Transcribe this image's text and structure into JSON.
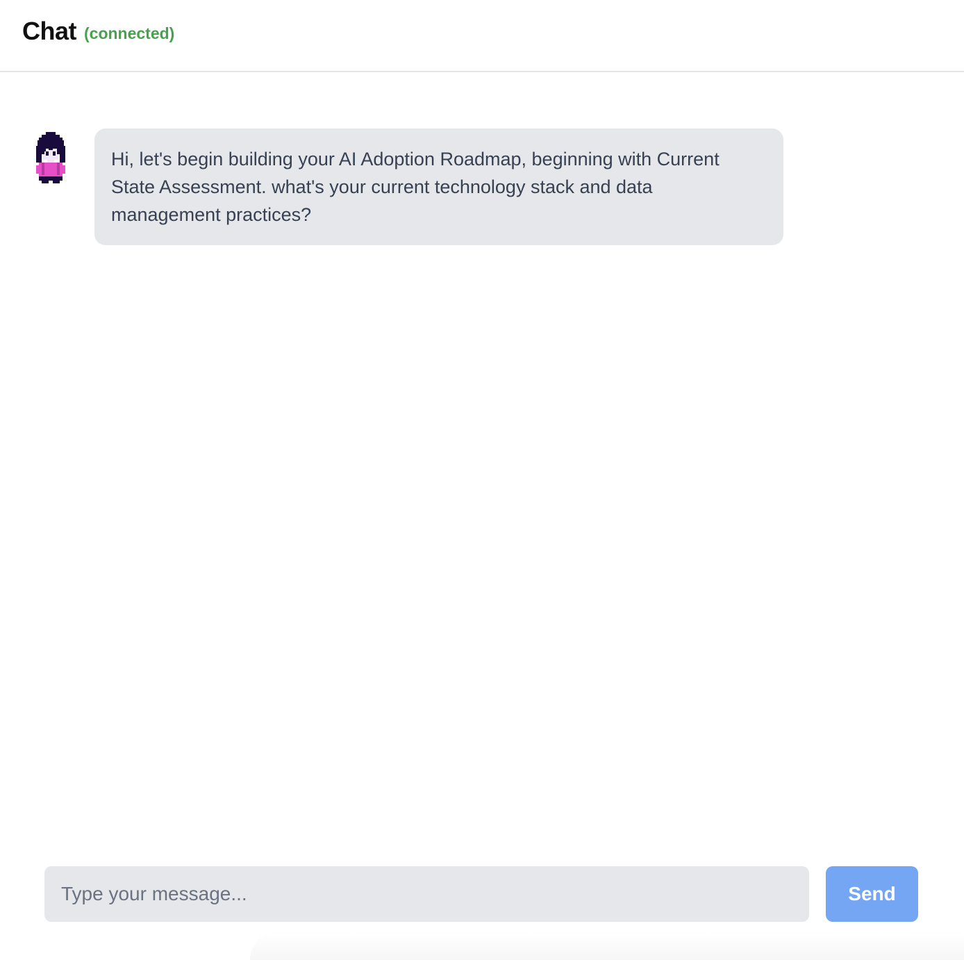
{
  "header": {
    "title": "Chat",
    "status": "(connected)",
    "status_color": "#47a34b"
  },
  "messages": [
    {
      "sender": "assistant",
      "avatar_icon": "pixel-character-avatar-icon",
      "text": "Hi, let's begin building your AI Adoption Roadmap, beginning with Current State Assessment. what's your current technology stack and data management practices?"
    }
  ],
  "composer": {
    "placeholder": "Type your message...",
    "value": "",
    "send_label": "Send",
    "send_color": "#75a6f3"
  }
}
